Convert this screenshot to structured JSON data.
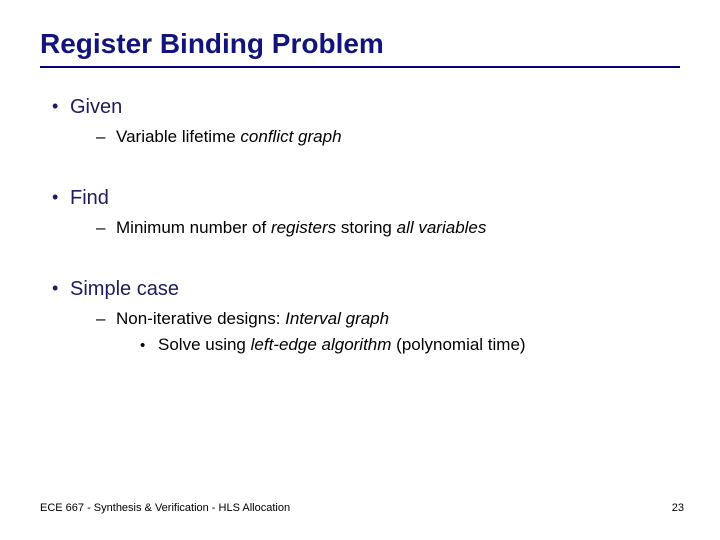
{
  "title": "Register Binding Problem",
  "sections": {
    "given": {
      "heading": "Given",
      "sub": [
        {
          "pre": "Variable lifetime ",
          "em": "conflict graph",
          "post": ""
        }
      ]
    },
    "find": {
      "heading": "Find",
      "sub": [
        {
          "pre": "Minimum number of ",
          "em": "registers",
          "post": " storing ",
          "em2": "all variables"
        }
      ]
    },
    "simple": {
      "heading": "Simple case",
      "sub": [
        {
          "pre": "Non-iterative designs: ",
          "em": "Interval graph",
          "post": ""
        }
      ],
      "subsub": [
        {
          "pre": "Solve using ",
          "em": "left-edge algorithm",
          "post": " (polynomial time)"
        }
      ]
    }
  },
  "footer": "ECE 667 - Synthesis & Verification - HLS Allocation",
  "page": "23"
}
